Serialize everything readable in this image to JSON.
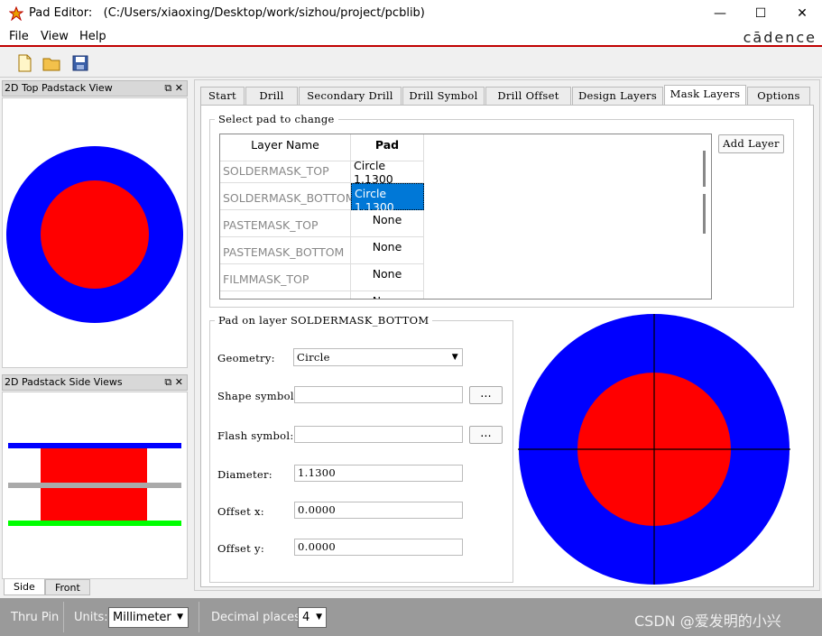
{
  "window": {
    "app_name": "Pad Editor:",
    "path": "(C:/Users/xiaoxing/Desktop/work/sizhou/project/pcblib)"
  },
  "menu": [
    "File",
    "View",
    "Help"
  ],
  "logo": "cādence",
  "toolbar": {
    "new": "new-file-icon",
    "open": "open-folder-icon",
    "save": "save-icon"
  },
  "panels": {
    "top_view_title": "2D Top Padstack View",
    "side_view_title": "2D Padstack Side Views",
    "side_tabs": [
      "Side",
      "Front"
    ],
    "panel_buttons": "⧉ ✕"
  },
  "tabs": [
    "Start",
    "Drill",
    "Secondary Drill",
    "Drill Symbol",
    "Drill Offset",
    "Design Layers",
    "Mask Layers",
    "Options"
  ],
  "active_tab": "Mask Layers",
  "select_group": {
    "legend": "Select pad to change",
    "col_layer": "Layer Name",
    "col_pad": "Pad",
    "rows": [
      {
        "layer": "SOLDERMASK_TOP",
        "pad": "Circle 1.1300"
      },
      {
        "layer": "SOLDERMASK_BOTTOM",
        "pad": "Circle 1.1300"
      },
      {
        "layer": "PASTEMASK_TOP",
        "pad": "None"
      },
      {
        "layer": "PASTEMASK_BOTTOM",
        "pad": "None"
      },
      {
        "layer": "FILMMASK_TOP",
        "pad": "None"
      },
      {
        "layer": "",
        "pad": "None"
      }
    ],
    "add_layer": "Add Layer"
  },
  "pad_group": {
    "legend": "Pad on layer SOLDERMASK_BOTTOM",
    "geometry_label": "Geometry:",
    "geometry_value": "Circle",
    "shape_label": "Shape symbol:",
    "shape_value": "",
    "flash_label": "Flash symbol:",
    "flash_value": "",
    "browse": "...",
    "diameter_label": "Diameter:",
    "diameter_value": "1.1300",
    "offx_label": "Offset x:",
    "offx_value": "0.0000",
    "offy_label": "Offset y:",
    "offy_value": "0.0000"
  },
  "status": {
    "mode": "Thru Pin",
    "units_label": "Units:",
    "units_value": "Millimeter",
    "decimal_label": "Decimal places:",
    "decimal_value": "4",
    "watermark": "CSDN @爱发明的小兴"
  },
  "colors": {
    "pad_outer": "#0000ff",
    "pad_inner": "#ff0000",
    "layer_green": "#00ff00",
    "layer_gray": "#aaaaaa",
    "selection": "#0078d7"
  }
}
